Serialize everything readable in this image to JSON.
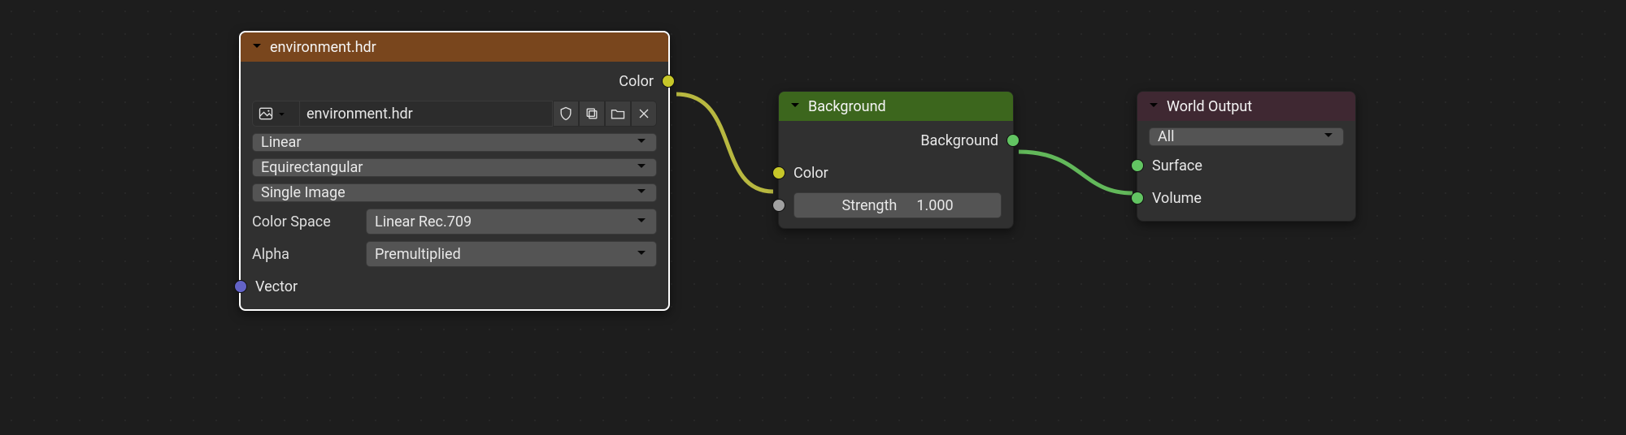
{
  "nodes": {
    "environment": {
      "title": "environment.hdr",
      "outputs": {
        "color": "Color"
      },
      "file_field": "environment.hdr",
      "interpolation": "Linear",
      "projection": "Equirectangular",
      "source": "Single Image",
      "color_space_label": "Color Space",
      "color_space": "Linear Rec.709",
      "alpha_label": "Alpha",
      "alpha": "Premultiplied",
      "inputs": {
        "vector": "Vector"
      }
    },
    "background": {
      "title": "Background",
      "outputs": {
        "background": "Background"
      },
      "inputs": {
        "color": "Color",
        "strength_label": "Strength",
        "strength_value": "1.000"
      }
    },
    "world_output": {
      "title": "World Output",
      "target": "All",
      "inputs": {
        "surface": "Surface",
        "volume": "Volume"
      }
    }
  },
  "icons": {
    "collapse": "chevron-down-icon",
    "image": "image-icon",
    "shield": "shield-icon",
    "duplicate": "duplicate-icon",
    "folder": "folder-icon",
    "close": "close-icon"
  }
}
